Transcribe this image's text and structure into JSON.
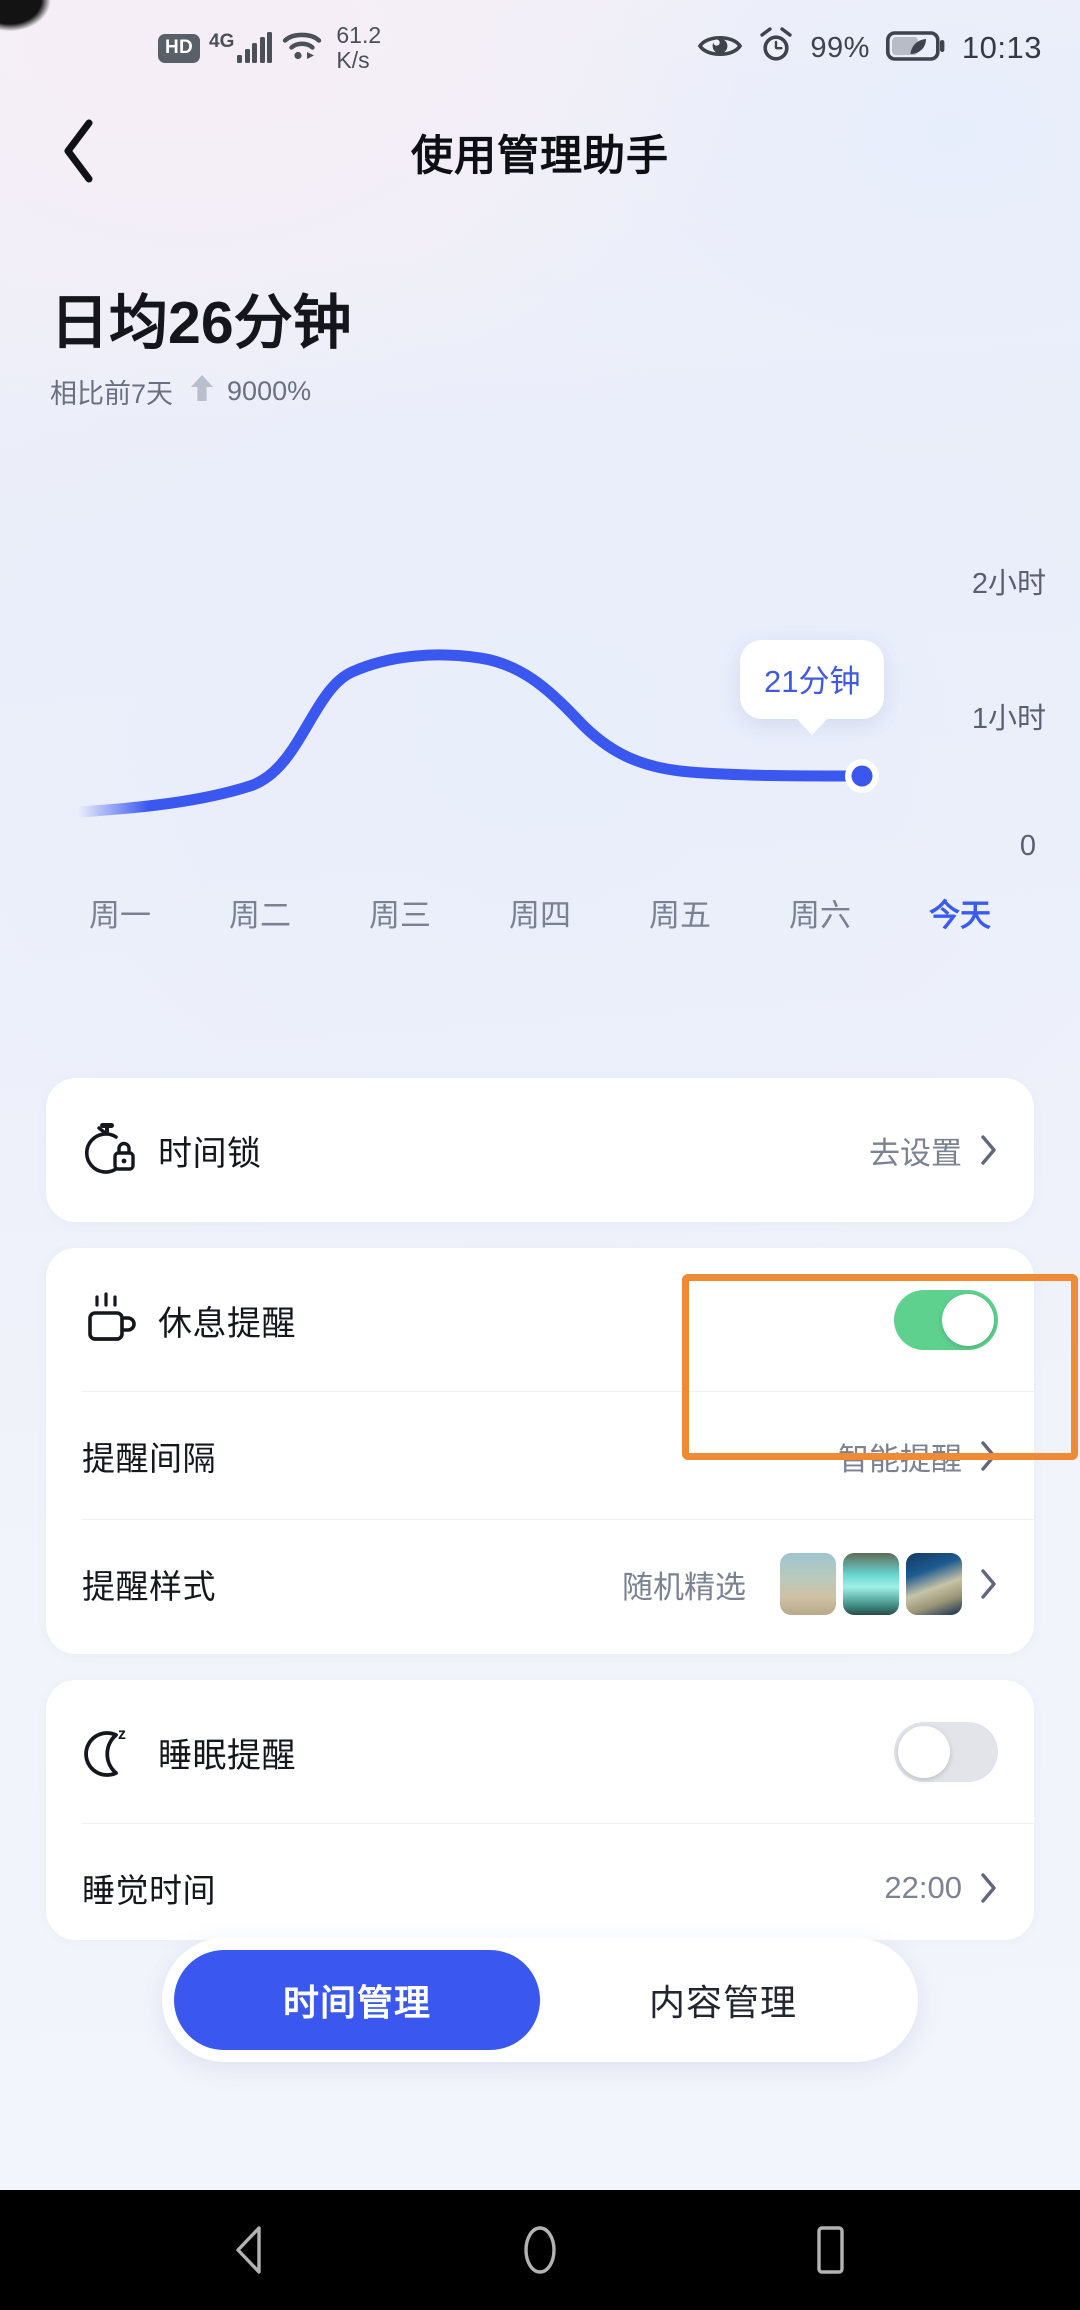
{
  "status_bar": {
    "hd_badge": "HD",
    "network_type": "4G",
    "net_speed_value": "61.2",
    "net_speed_unit": "K/s",
    "eye_icon": "eye-comfort-icon",
    "alarm_icon": "alarm-clock-icon",
    "battery_percent": "99%",
    "battery_icon": "battery-eco-icon",
    "time": "10:13"
  },
  "header": {
    "back_icon": "back-chevron-icon",
    "title": "使用管理助手"
  },
  "summary": {
    "avg_prefix": "日均",
    "avg_value": "26",
    "avg_unit": "分钟",
    "compare_label": "相比前7天",
    "compare_arrow": "up-arrow-icon",
    "compare_value": "9000%"
  },
  "chart_data": {
    "type": "line",
    "title": "",
    "xlabel": "",
    "ylabel": "",
    "categories": [
      "周一",
      "周二",
      "周三",
      "周四",
      "周五",
      "周六",
      "今天"
    ],
    "values": [
      4,
      8,
      95,
      92,
      30,
      22,
      21
    ],
    "unit": "分钟",
    "ylim": [
      0,
      120
    ],
    "y_ticks": [
      "2小时",
      "1小时",
      "0"
    ],
    "grid": false,
    "legend": "none",
    "active_index": 6,
    "highlight_value": "21分钟",
    "line_color": "#3a57f0",
    "point_color": "#3a57f0"
  },
  "day_tabs": [
    {
      "label": "周一",
      "active": false
    },
    {
      "label": "周二",
      "active": false
    },
    {
      "label": "周三",
      "active": false
    },
    {
      "label": "周四",
      "active": false
    },
    {
      "label": "周五",
      "active": false
    },
    {
      "label": "周六",
      "active": false
    },
    {
      "label": "今天",
      "active": true
    }
  ],
  "cards": {
    "time_lock": {
      "icon": "stopwatch-lock-icon",
      "label": "时间锁",
      "value": "去设置",
      "chevron": "chevron-right-icon"
    },
    "rest_reminder": {
      "icon": "coffee-cup-icon",
      "label": "休息提醒",
      "toggle_state": "on",
      "rows": [
        {
          "label": "提醒间隔",
          "value": "智能提醒",
          "chevron": "chevron-right-icon"
        },
        {
          "label": "提醒样式",
          "value": "随机精选",
          "chevron": "chevron-right-icon",
          "thumbnails": [
            "lighthouse-beach-thumb",
            "turquoise-waterfall-thumb",
            "dark-coastline-thumb"
          ]
        }
      ]
    },
    "sleep_reminder": {
      "icon": "moon-sleep-icon",
      "label": "睡眠提醒",
      "toggle_state": "off",
      "rows": [
        {
          "label": "睡觉时间",
          "value": "22:00",
          "chevron": "chevron-right-icon"
        }
      ]
    }
  },
  "tab_bar": [
    {
      "label": "时间管理",
      "active": true
    },
    {
      "label": "内容管理",
      "active": false
    }
  ],
  "annotation": {
    "target": "rest-reminder-toggle",
    "color": "#ef8b35"
  },
  "nav_bar": {
    "back": "nav-back-icon",
    "home": "nav-home-icon",
    "recents": "nav-recents-icon"
  },
  "colors": {
    "accent_blue": "#3a57f0",
    "toggle_green": "#5ed18f",
    "annotation_orange": "#ef8b35"
  }
}
